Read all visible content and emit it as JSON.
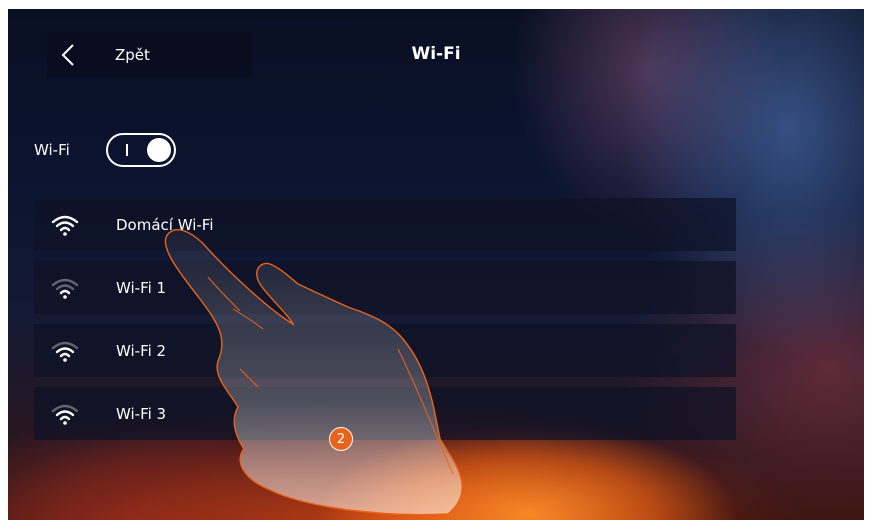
{
  "header": {
    "back_label": "Zpět",
    "title": "Wi-Fi"
  },
  "wifi_toggle": {
    "label": "Wi-Fi",
    "state": "on"
  },
  "networks": [
    {
      "name": "Domácí Wi-Fi",
      "icon": "wifi-icon",
      "signal": "strong"
    },
    {
      "name": "Wi-Fi 1",
      "icon": "wifi-icon",
      "signal": "weak"
    },
    {
      "name": "Wi-Fi 2",
      "icon": "wifi-icon",
      "signal": "medium"
    },
    {
      "name": "Wi-Fi 3",
      "icon": "wifi-icon",
      "signal": "medium"
    }
  ],
  "step_badge": "2",
  "colors": {
    "accent": "#e8641a",
    "text": "#ffffff",
    "panel": "#0e1226"
  }
}
